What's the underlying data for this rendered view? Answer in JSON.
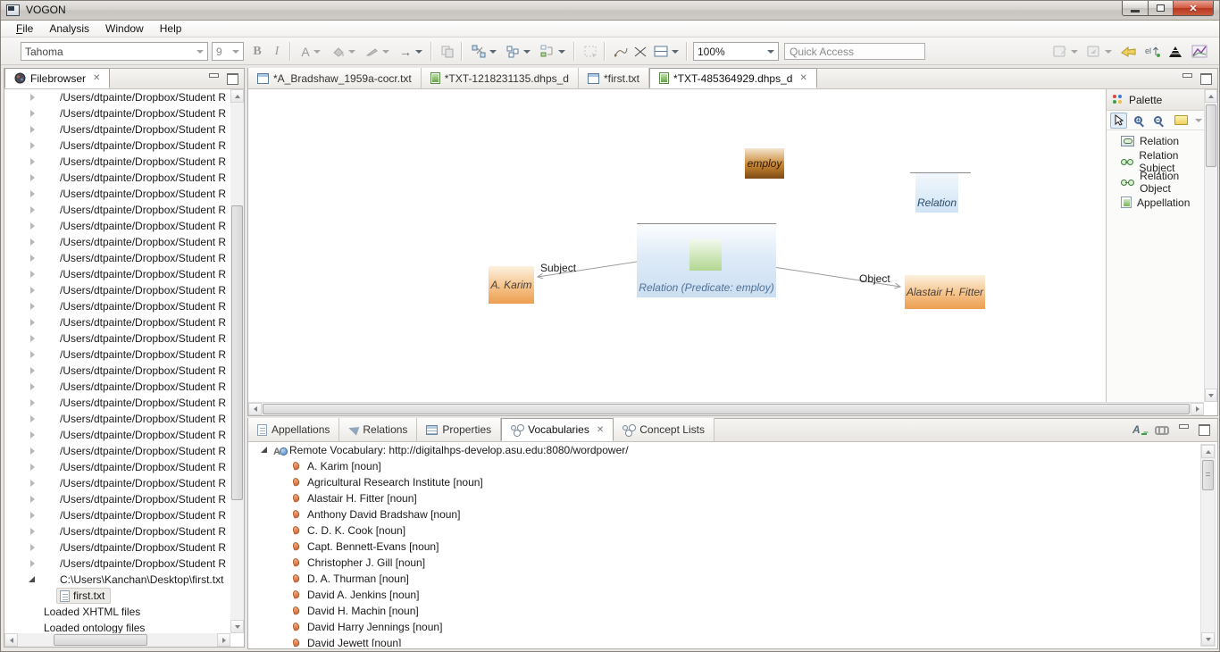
{
  "window": {
    "title": "VOGON"
  },
  "menu": {
    "items": [
      "File",
      "Analysis",
      "Window",
      "Help"
    ]
  },
  "toolbar": {
    "font_family_value": "Tahoma",
    "font_size_value": "9",
    "bold_label": "B",
    "italic_label": "I",
    "font_color_label": "A",
    "zoom_value": "100%",
    "quick_access_placeholder": "Quick Access"
  },
  "icons": {
    "close": "✕"
  },
  "colors": {
    "predicate_node": "#8a521d",
    "appellation_node": "#ec9f50",
    "relation_node": "#cfe4f6",
    "relation_handle": "#b2d792",
    "close_button": "#b83722"
  },
  "filebrowser": {
    "title": "Filebrowser",
    "tree_items": [
      "/Users/dtpainte/Dropbox/Student R",
      "/Users/dtpainte/Dropbox/Student R",
      "/Users/dtpainte/Dropbox/Student R",
      "/Users/dtpainte/Dropbox/Student R",
      "/Users/dtpainte/Dropbox/Student R",
      "/Users/dtpainte/Dropbox/Student R",
      "/Users/dtpainte/Dropbox/Student R",
      "/Users/dtpainte/Dropbox/Student R",
      "/Users/dtpainte/Dropbox/Student R",
      "/Users/dtpainte/Dropbox/Student R",
      "/Users/dtpainte/Dropbox/Student R",
      "/Users/dtpainte/Dropbox/Student R",
      "/Users/dtpainte/Dropbox/Student R",
      "/Users/dtpainte/Dropbox/Student R",
      "/Users/dtpainte/Dropbox/Student R",
      "/Users/dtpainte/Dropbox/Student R",
      "/Users/dtpainte/Dropbox/Student R",
      "/Users/dtpainte/Dropbox/Student R",
      "/Users/dtpainte/Dropbox/Student R",
      "/Users/dtpainte/Dropbox/Student R",
      "/Users/dtpainte/Dropbox/Student R",
      "/Users/dtpainte/Dropbox/Student R",
      "/Users/dtpainte/Dropbox/Student R",
      "/Users/dtpainte/Dropbox/Student R",
      "/Users/dtpainte/Dropbox/Student R",
      "/Users/dtpainte/Dropbox/Student R",
      "/Users/dtpainte/Dropbox/Student R",
      "/Users/dtpainte/Dropbox/Student R",
      "/Users/dtpainte/Dropbox/Student R",
      "/Users/dtpainte/Dropbox/Student R"
    ],
    "expanded_item": "C:\\Users\\Kanchan\\Desktop\\first.txt",
    "selected_file": "first.txt",
    "root_items": [
      "Loaded XHTML files",
      "Loaded ontology files"
    ]
  },
  "editor": {
    "tabs": [
      {
        "label": "*A_Bradshaw_1959a-cocr.txt"
      },
      {
        "label": "*TXT-1218231135.dhps_d"
      },
      {
        "label": "*first.txt"
      },
      {
        "label": "*TXT-485364929.dhps_d"
      }
    ]
  },
  "canvas": {
    "predicate_node": "employ",
    "relation_class_node": "Relation",
    "relation_node": "Relation (Predicate: employ)",
    "subject_node": "A. Karim",
    "object_node": "Alastair H. Fitter",
    "subject_edge_label": "Subject",
    "object_edge_label": "Object"
  },
  "palette": {
    "title": "Palette",
    "items": [
      "Relation",
      "Relation Subject",
      "Relation Object",
      "Appellation"
    ]
  },
  "bottom": {
    "tabs": [
      "Appellations",
      "Relations",
      "Properties",
      "Vocabularies",
      "Concept Lists"
    ],
    "active_tab": "Vocabularies",
    "vocabulary_root": "Remote Vocabulary: http://digitalhps-develop.asu.edu:8080/wordpower/",
    "entries": [
      "A. Karim [noun]",
      "Agricultural Research Institute [noun]",
      "Alastair H. Fitter [noun]",
      "Anthony David Bradshaw [noun]",
      "C. D. K. Cook [noun]",
      "Capt. Bennett-Evans [noun]",
      "Christopher J. Gill [noun]",
      "D. A. Thurman [noun]",
      "David A. Jenkins [noun]",
      "David H. Machin [noun]",
      "David Harry Jennings [noun]",
      "David Jewett [noun]"
    ]
  }
}
